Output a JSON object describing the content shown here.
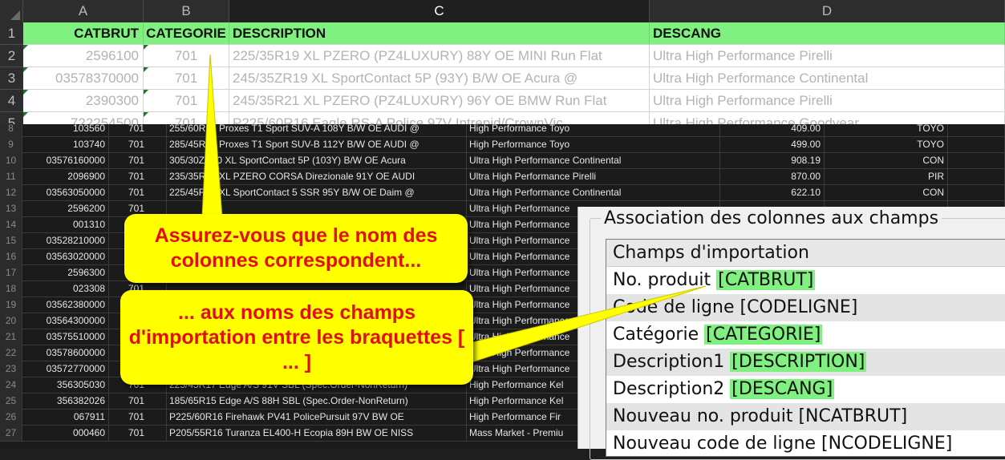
{
  "spreadsheet": {
    "column_headers": [
      "A",
      "B",
      "C",
      "D"
    ],
    "rows": [
      {
        "num": "1",
        "a": "CATBRUT",
        "b": "CATEGORIE",
        "c": "DESCRIPTION",
        "d": "DESCANG"
      },
      {
        "num": "2",
        "a": "2596100",
        "b": "701",
        "c": "225/35R19 XL PZERO (PZ4LUXURY) 88Y OE MINI Run Flat",
        "d": "Ultra High Performance Pirelli"
      },
      {
        "num": "3",
        "a": "03578370000",
        "b": "701",
        "c": "245/35ZR19 XL SportContact 5P (93Y) B/W OE Acura @",
        "d": "Ultra High Performance Continental"
      },
      {
        "num": "4",
        "a": "2390300",
        "b": "701",
        "c": "245/35R21 XL PZERO (PZ4LUXURY) 96Y OE BMW Run Flat",
        "d": "Ultra High Performance Pirelli"
      },
      {
        "num": "5",
        "a": "722254500",
        "b": "701",
        "c": "P225/60R16 Eagle RS-A Police 97V Intrepid/CrownVic",
        "d": "Ultra High Performance Goodyear"
      }
    ]
  },
  "background_sheet": {
    "rows": [
      {
        "num": "8",
        "a": "103560",
        "b": "701",
        "c": "255/60R18 Proxes T1 Sport SUV-A 108Y B/W OE AUDI @",
        "d": "High Performance Toyo",
        "e": "409.00",
        "f": "TOYO"
      },
      {
        "num": "9",
        "a": "103740",
        "b": "701",
        "c": "285/45R19 Proxes T1 Sport SUV-B 112Y B/W OE AUDI @",
        "d": "High Performance Toyo",
        "e": "499.00",
        "f": "TOYO"
      },
      {
        "num": "10",
        "a": "03576160000",
        "b": "701",
        "c": "305/30ZR20 XL SportContact 5P (103Y) B/W OE Acura",
        "d": "Ultra High Performance Continental",
        "e": "908.19",
        "f": "CON"
      },
      {
        "num": "11",
        "a": "2096900",
        "b": "701",
        "c": "235/35R19 XL PZERO CORSA Direzionale 91Y OE AUDI",
        "d": "Ultra High Performance Pirelli",
        "e": "870.00",
        "f": "PIR"
      },
      {
        "num": "12",
        "a": "03563050000",
        "b": "701",
        "c": "225/45R18 XL SportContact 5 SSR 95Y B/W OE Daim @",
        "d": "Ultra High Performance Continental",
        "e": "622.10",
        "f": "CON"
      },
      {
        "num": "13",
        "a": "2596200",
        "b": "701",
        "c": "",
        "d": "Ultra High Performance",
        "e": "",
        "f": ""
      },
      {
        "num": "14",
        "a": "001310",
        "b": "701",
        "c": "",
        "d": "Ultra High Performance",
        "e": "",
        "f": ""
      },
      {
        "num": "15",
        "a": "03528210000",
        "b": "701",
        "c": "",
        "d": "Ultra High Performance",
        "e": "",
        "f": ""
      },
      {
        "num": "16",
        "a": "03563020000",
        "b": "701",
        "c": "",
        "d": "Ultra High Performance",
        "e": "",
        "f": ""
      },
      {
        "num": "17",
        "a": "2596300",
        "b": "701",
        "c": "",
        "d": "Ultra High Performance",
        "e": "",
        "f": ""
      },
      {
        "num": "18",
        "a": "023308",
        "b": "701",
        "c": "",
        "d": "Ultra High Performance",
        "e": "",
        "f": ""
      },
      {
        "num": "19",
        "a": "03562380000",
        "b": "701",
        "c": "",
        "d": "Ultra High Performance",
        "e": "",
        "f": ""
      },
      {
        "num": "20",
        "a": "03564300000",
        "b": "701",
        "c": "",
        "d": "Ultra High Performance",
        "e": "",
        "f": ""
      },
      {
        "num": "21",
        "a": "03575510000",
        "b": "701",
        "c": "",
        "d": "Ultra High Performance",
        "e": "",
        "f": ""
      },
      {
        "num": "22",
        "a": "03578600000",
        "b": "701",
        "c": "",
        "d": "Ultra High Performance",
        "e": "",
        "f": ""
      },
      {
        "num": "23",
        "a": "03572770000",
        "b": "701",
        "c": "",
        "d": "Ultra High Performance",
        "e": "",
        "f": ""
      },
      {
        "num": "24",
        "a": "356305030",
        "b": "701",
        "c": "225/45R17 Edge A/S 91V SBL (Spec.Order-NonReturn)",
        "d": "High Performance Kel",
        "e": "",
        "f": ""
      },
      {
        "num": "25",
        "a": "356382026",
        "b": "701",
        "c": "185/65R15 Edge A/S 88H SBL (Spec.Order-NonReturn)",
        "d": "High Performance Kel",
        "e": "",
        "f": ""
      },
      {
        "num": "26",
        "a": "067911",
        "b": "701",
        "c": "P225/60R16 Firehawk PV41 PolicePursuit 97V BW OE",
        "d": "High Performance Fir",
        "e": "",
        "f": ""
      },
      {
        "num": "27",
        "a": "000460",
        "b": "701",
        "c": "P205/55R16 Turanza EL400-H Ecopia 89H BW OE NISS",
        "d": "Mass Market - Premiu",
        "e": "",
        "f": ""
      }
    ]
  },
  "dialog": {
    "group_title": "Association des colonnes aux champs",
    "list_header": "Champs d'importation",
    "fields": [
      {
        "label": "No. produit",
        "key": "[CATBRUT]",
        "highlight": true
      },
      {
        "label": "Code de ligne",
        "key": "[CODELIGNE]",
        "highlight": false
      },
      {
        "label": "Catégorie",
        "key": "[CATEGORIE]",
        "highlight": true
      },
      {
        "label": "Description1",
        "key": "[DESCRIPTION]",
        "highlight": true
      },
      {
        "label": "Description2",
        "key": "[DESCANG]",
        "highlight": true
      },
      {
        "label": "Nouveau no. produit",
        "key": "[NCATBRUT]",
        "highlight": false
      },
      {
        "label": "Nouveau code de ligne",
        "key": "[NCODELIGNE]",
        "highlight": false
      }
    ]
  },
  "callouts": {
    "first": "Assurez-vous que le nom des colonnes correspondent...",
    "second": "... aux noms des champs d'importation entre les braquettes [ ... ]"
  },
  "colors": {
    "header_green": "#80f080",
    "callout_fill": "#ffff00",
    "callout_text": "#e01010"
  }
}
